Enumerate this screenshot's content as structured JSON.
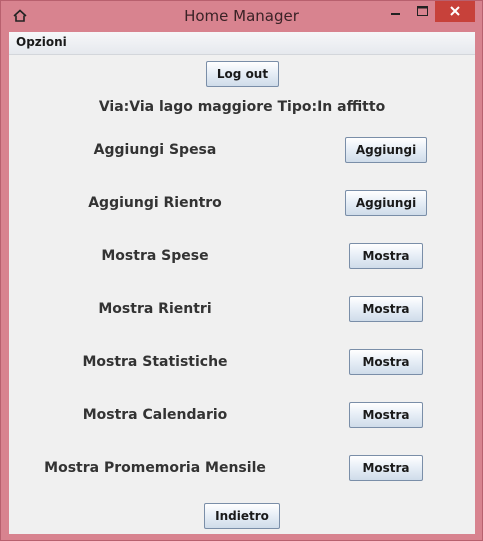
{
  "window": {
    "title": "Home Manager",
    "icons": {
      "app": "house-icon",
      "minimize": "minimize-icon",
      "maximize": "maximize-icon",
      "close": "close-icon"
    }
  },
  "menubar": {
    "options_label": "Opzioni"
  },
  "header": {
    "logout_label": "Log out",
    "info_text": "Via:Via lago maggiore Tipo:In affitto"
  },
  "rows": [
    {
      "label": "Aggiungi Spesa",
      "button": "Aggiungi"
    },
    {
      "label": "Aggiungi Rientro",
      "button": "Aggiungi"
    },
    {
      "label": "Mostra Spese",
      "button": "Mostra"
    },
    {
      "label": "Mostra Rientri",
      "button": "Mostra"
    },
    {
      "label": "Mostra Statistiche",
      "button": "Mostra"
    },
    {
      "label": "Mostra Calendario",
      "button": "Mostra"
    },
    {
      "label": "Mostra Promemoria Mensile",
      "button": "Mostra"
    }
  ],
  "footer": {
    "back_label": "Indietro"
  },
  "colors": {
    "frame": "#d8838f",
    "close": "#c7413a",
    "client": "#f0f0f0"
  }
}
